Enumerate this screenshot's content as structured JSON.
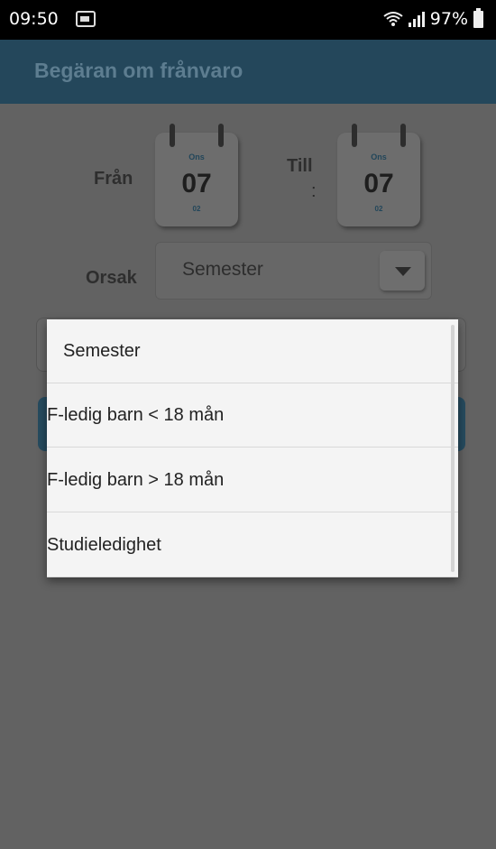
{
  "status_bar": {
    "time": "09:50",
    "battery": "97%"
  },
  "app_bar": {
    "title": "Begäran om frånvaro"
  },
  "form": {
    "from_label": "Från",
    "to_label_line1": "Till",
    "to_label_line2": ":",
    "from_date": {
      "weekday": "Ons",
      "day": "07",
      "month": "02"
    },
    "to_date": {
      "weekday": "Ons",
      "day": "07",
      "month": "02"
    },
    "reason_label": "Orsak",
    "reason_value": "Semester"
  },
  "dropdown": {
    "options": [
      "Semester",
      "F-ledig barn < 18 mån",
      "F-ledig barn > 18 mån",
      "Studieledighet"
    ]
  },
  "colors": {
    "app_bar": "#24475b",
    "dim_background": "#626262",
    "popup": "#f4f4f4"
  }
}
